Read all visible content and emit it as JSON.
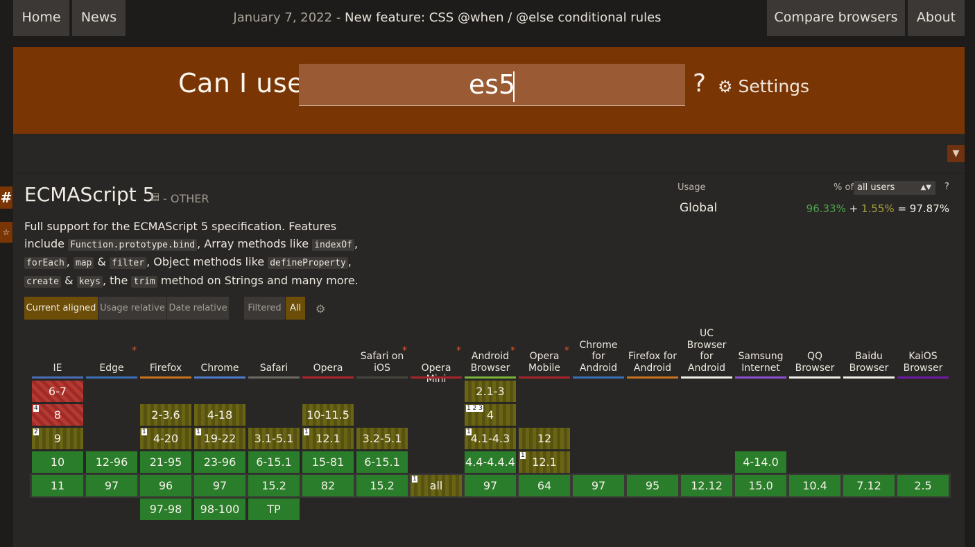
{
  "nav": {
    "home": "Home",
    "news": "News",
    "announcement_date": "January 7, 2022",
    "announcement_sep": " - ",
    "announcement_text": "New feature: CSS @when / @else conditional rules",
    "compare": "Compare browsers",
    "about": "About"
  },
  "search": {
    "title": "Can I use",
    "value": "es5",
    "help": "?",
    "settings": "Settings"
  },
  "feature": {
    "title": "ECMAScript 5",
    "status": "- OTHER",
    "description_parts": {
      "p1": "Full support for the ECMAScript 5 specification. Features include",
      "c1": "Function.prototype.bind",
      "p2": ", Array methods like",
      "c2": "indexOf",
      "c3": "forEach",
      "c4": "map",
      "p3": "&",
      "c5": "filter",
      "p4": ", Object methods like",
      "c6": "defineProperty",
      "c7": "create",
      "p5": "&",
      "c8": "keys",
      "p6": ", the",
      "c9": "trim",
      "p7": "method on Strings and many more."
    }
  },
  "usage": {
    "label": "Usage",
    "pct_of": "% of",
    "users": "all users",
    "help": "?",
    "region": "Global",
    "full": "96.33%",
    "plus": "+",
    "partial": "1.55%",
    "equals": "=",
    "total": "97.87%"
  },
  "toggles": {
    "current": "Current aligned",
    "usage_rel": "Usage relative",
    "date_rel": "Date relative",
    "filtered": "Filtered",
    "all": "All"
  },
  "colors": {
    "header_brand": "#7a3505",
    "supported": "#2a7d2a",
    "not_supported": "#a02a26",
    "partial": "#6a6514"
  },
  "browsers": [
    {
      "name": "IE",
      "asterisk": false,
      "color": "#4a6eb5",
      "cells": [
        {
          "v": "6-7",
          "s": "n",
          "note": ""
        },
        {
          "v": "8",
          "s": "n",
          "note": "4"
        },
        {
          "v": "9",
          "s": "a",
          "note": "2"
        },
        {
          "v": "10",
          "s": "y",
          "note": ""
        },
        {
          "v": "11",
          "s": "y",
          "note": ""
        }
      ]
    },
    {
      "name": "Edge",
      "asterisk": true,
      "color": "#3c6fb3",
      "cells": [
        null,
        null,
        null,
        {
          "v": "12-96",
          "s": "y",
          "note": ""
        },
        {
          "v": "97",
          "s": "y",
          "note": ""
        }
      ]
    },
    {
      "name": "Firefox",
      "asterisk": false,
      "color": "#c8741f",
      "cells": [
        null,
        {
          "v": "2-3.6",
          "s": "a",
          "note": ""
        },
        {
          "v": "4-20",
          "s": "a",
          "note": "1"
        },
        {
          "v": "21-95",
          "s": "y",
          "note": ""
        },
        {
          "v": "96",
          "s": "y",
          "note": ""
        },
        {
          "v": "97-98",
          "s": "y",
          "note": ""
        }
      ]
    },
    {
      "name": "Chrome",
      "asterisk": false,
      "color": "#4a7cc9",
      "cells": [
        null,
        {
          "v": "4-18",
          "s": "a",
          "note": ""
        },
        {
          "v": "19-22",
          "s": "a",
          "note": "1"
        },
        {
          "v": "23-96",
          "s": "y",
          "note": ""
        },
        {
          "v": "97",
          "s": "y",
          "note": ""
        },
        {
          "v": "98-100",
          "s": "y",
          "note": ""
        }
      ]
    },
    {
      "name": "Safari",
      "asterisk": false,
      "color": "#6d6a66",
      "cells": [
        null,
        null,
        {
          "v": "3.1-5.1",
          "s": "a",
          "note": ""
        },
        {
          "v": "6-15.1",
          "s": "y",
          "note": ""
        },
        {
          "v": "15.2",
          "s": "y",
          "note": ""
        },
        {
          "v": "TP",
          "s": "y",
          "note": ""
        }
      ]
    },
    {
      "name": "Opera",
      "asterisk": false,
      "color": "#b0252a",
      "cells": [
        null,
        {
          "v": "10-11.5",
          "s": "a",
          "note": ""
        },
        {
          "v": "12.1",
          "s": "a",
          "note": "1"
        },
        {
          "v": "15-81",
          "s": "y",
          "note": ""
        },
        {
          "v": "82",
          "s": "y",
          "note": ""
        }
      ]
    },
    {
      "name": "Safari on iOS",
      "asterisk": true,
      "color": "#47443f",
      "cells": [
        null,
        null,
        {
          "v": "3.2-5.1",
          "s": "a",
          "note": ""
        },
        {
          "v": "6-15.1",
          "s": "y",
          "note": ""
        },
        {
          "v": "15.2",
          "s": "y",
          "note": ""
        }
      ]
    },
    {
      "name": "Opera Mini",
      "asterisk": true,
      "color": "#a8232a",
      "cells": [
        null,
        null,
        null,
        null,
        {
          "v": "all",
          "s": "a",
          "note": "1"
        }
      ]
    },
    {
      "name": "Android Browser",
      "asterisk": true,
      "color": "#7ab339",
      "cells": [
        {
          "v": "2.1-3",
          "s": "a",
          "note": ""
        },
        {
          "v": "4",
          "s": "a",
          "note": "1 2 3"
        },
        {
          "v": "4.1-4.3",
          "s": "a",
          "note": "1"
        },
        {
          "v": "4.4-4.4.4",
          "s": "y",
          "note": ""
        },
        {
          "v": "97",
          "s": "y",
          "note": ""
        }
      ]
    },
    {
      "name": "Opera Mobile",
      "asterisk": true,
      "color": "#a8232a",
      "cells": [
        null,
        null,
        {
          "v": "12",
          "s": "a",
          "note": ""
        },
        {
          "v": "12.1",
          "s": "a",
          "note": "1"
        },
        {
          "v": "64",
          "s": "y",
          "note": ""
        }
      ]
    },
    {
      "name": "Chrome for Android",
      "asterisk": false,
      "color": "#3c6fb3",
      "cells": [
        null,
        null,
        null,
        null,
        {
          "v": "97",
          "s": "y",
          "note": ""
        }
      ]
    },
    {
      "name": "Firefox for Android",
      "asterisk": false,
      "color": "#c8741f",
      "cells": [
        null,
        null,
        null,
        null,
        {
          "v": "95",
          "s": "y",
          "note": ""
        }
      ]
    },
    {
      "name": "UC Browser for Android",
      "asterisk": false,
      "color": "#f2efe8",
      "cells": [
        null,
        null,
        null,
        null,
        {
          "v": "12.12",
          "s": "y",
          "note": ""
        }
      ]
    },
    {
      "name": "Samsung Internet",
      "asterisk": false,
      "color": "#8e4fd6",
      "cells": [
        null,
        null,
        null,
        {
          "v": "4-14.0",
          "s": "y",
          "note": ""
        },
        {
          "v": "15.0",
          "s": "y",
          "note": ""
        }
      ]
    },
    {
      "name": "QQ Browser",
      "asterisk": false,
      "color": "#f2efe8",
      "cells": [
        null,
        null,
        null,
        null,
        {
          "v": "10.4",
          "s": "y",
          "note": ""
        }
      ]
    },
    {
      "name": "Baidu Browser",
      "asterisk": false,
      "color": "#f2efe8",
      "cells": [
        null,
        null,
        null,
        null,
        {
          "v": "7.12",
          "s": "y",
          "note": ""
        }
      ]
    },
    {
      "name": "KaiOS Browser",
      "asterisk": false,
      "color": "#6c1aa8",
      "cells": [
        null,
        null,
        null,
        null,
        {
          "v": "2.5",
          "s": "y",
          "note": ""
        }
      ]
    }
  ]
}
